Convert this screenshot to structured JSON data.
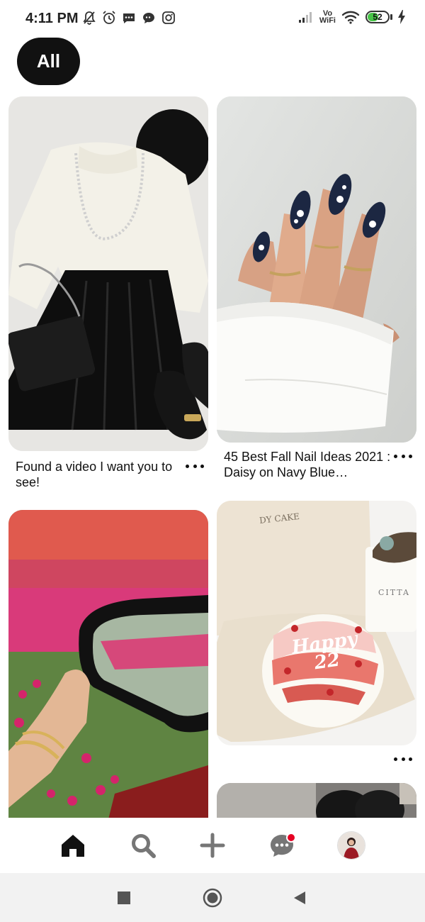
{
  "status_bar": {
    "time": "4:11 PM",
    "left_icons": [
      "mute-icon",
      "alarm-icon",
      "message-icon",
      "chat-bubble-icon",
      "instagram-icon"
    ],
    "network_label_top": "Vo",
    "network_label_bottom": "WiFi",
    "battery_percent": "52",
    "battery_level": 0.52,
    "battery_color": "#48c448"
  },
  "filter": {
    "label": "All"
  },
  "pins": [
    {
      "title": "Found a video I want you to see!",
      "image": "outfit-flatlay"
    },
    {
      "title": "45 Best Fall Nail Ideas 2021 : Daisy on Navy Blue…",
      "image": "navy-daisy-nails"
    },
    {
      "title": "",
      "image": "tulip-field-car-mirror"
    },
    {
      "title": "",
      "image": "happy-22-cake",
      "brand_text": "DY CAKE",
      "cake_text": "Happy 22",
      "candle_text": "CITTA"
    },
    {
      "title": "",
      "image": "shoes-partial"
    }
  ],
  "bottom_nav": {
    "items": [
      "home-icon",
      "search-icon",
      "create-icon",
      "messages-icon",
      "profile-avatar"
    ],
    "active": "home-icon",
    "notification_color": "#e60023"
  },
  "system_nav": [
    "recent-apps-icon",
    "home-circle-icon",
    "back-icon"
  ]
}
